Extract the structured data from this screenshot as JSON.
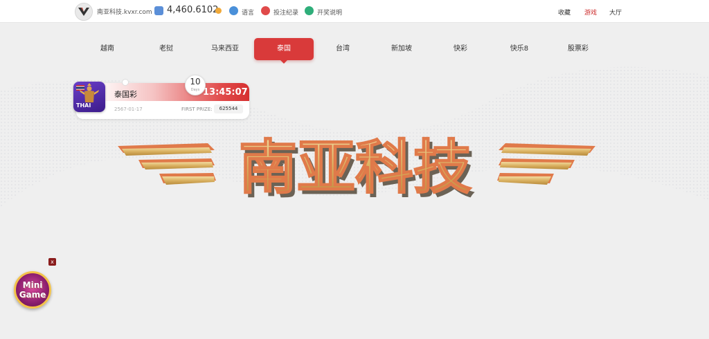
{
  "header": {
    "site_name": "南亚科技.kvxr.com",
    "balance": "4,460.6102",
    "tools": [
      {
        "label": "语言",
        "icon": "globe-icon",
        "color": "#4a90d9"
      },
      {
        "label": "投注纪录",
        "icon": "record-icon",
        "color": "#e04a4a"
      },
      {
        "label": "开奖说明",
        "icon": "info-icon",
        "color": "#2fae7a"
      }
    ],
    "right_nav": [
      {
        "label": "收藏",
        "active": false
      },
      {
        "label": "游戏",
        "active": true
      },
      {
        "label": "大厅",
        "active": false
      }
    ]
  },
  "nav": {
    "items": [
      "越南",
      "老挝",
      "马来西亚",
      "泰国",
      "台湾",
      "新加坡",
      "快彩",
      "快乐8",
      "股票彩"
    ],
    "active_index": 3
  },
  "card": {
    "badge": "THAI",
    "name": "泰国彩",
    "time": "13:45:07",
    "date": "2567-01-17",
    "prize_label": "FIRST PRIZE:",
    "prize_value": "625544",
    "countdown": "10",
    "countdown_unit": "Days"
  },
  "hero": {
    "title": "南亚科技"
  },
  "mini_game": {
    "line1": "Mini",
    "line2": "Game",
    "close": "x"
  },
  "colors": {
    "accent": "#d93a3a",
    "gold": "#e8c27a"
  }
}
